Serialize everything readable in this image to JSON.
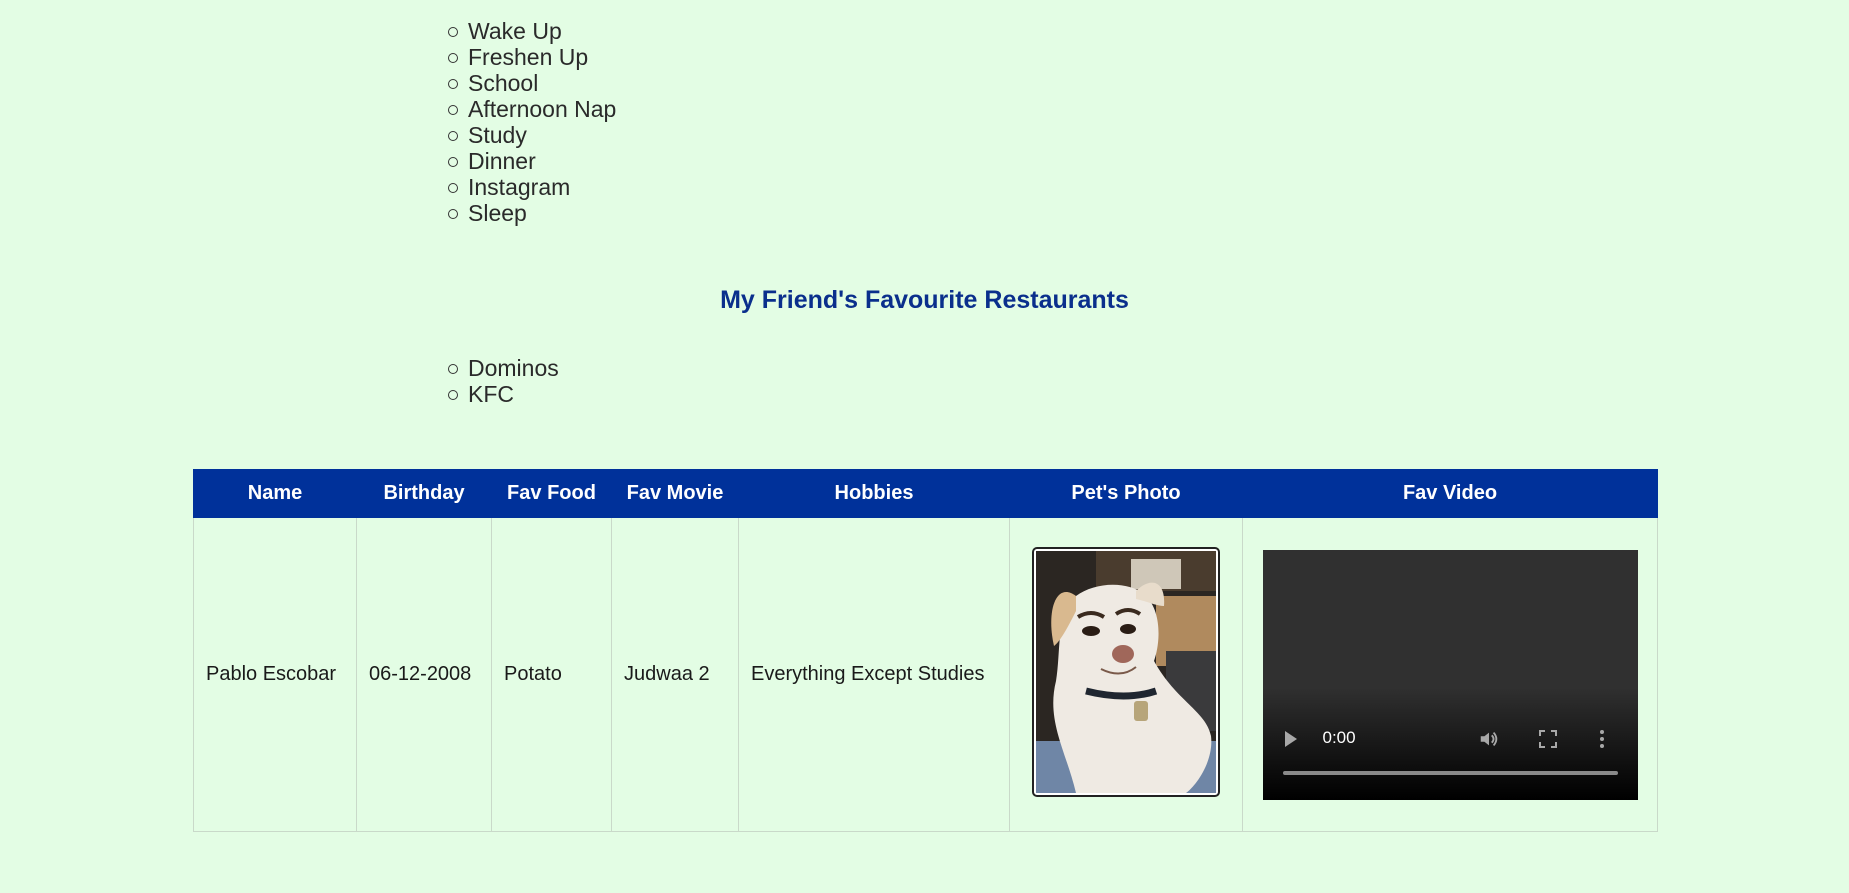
{
  "routine": {
    "items": [
      "Wake Up",
      "Freshen Up",
      "School",
      "Afternoon Nap",
      "Study",
      "Dinner",
      "Instagram",
      "Sleep"
    ]
  },
  "restaurants": {
    "heading": "My Friend's Favourite Restaurants",
    "items": [
      "Dominos",
      "KFC"
    ]
  },
  "table": {
    "headers": {
      "name": "Name",
      "birthday": "Birthday",
      "fav_food": "Fav Food",
      "fav_movie": "Fav Movie",
      "hobbies": "Hobbies",
      "pets_photo": "Pet's Photo",
      "fav_video": "Fav Video"
    },
    "rows": [
      {
        "name": "Pablo Escobar",
        "birthday": "06-12-2008",
        "fav_food": "Potato",
        "fav_movie": "Judwaa 2",
        "hobbies": "Everything Except Studies"
      }
    ]
  },
  "video": {
    "time": "0:00",
    "progress": 0
  },
  "colors": {
    "background": "#e3fde4",
    "heading": "#0a2f8c",
    "table_header": "#00319a"
  },
  "icons": [
    "play-icon",
    "volume-icon",
    "fullscreen-icon",
    "more-options-icon"
  ]
}
